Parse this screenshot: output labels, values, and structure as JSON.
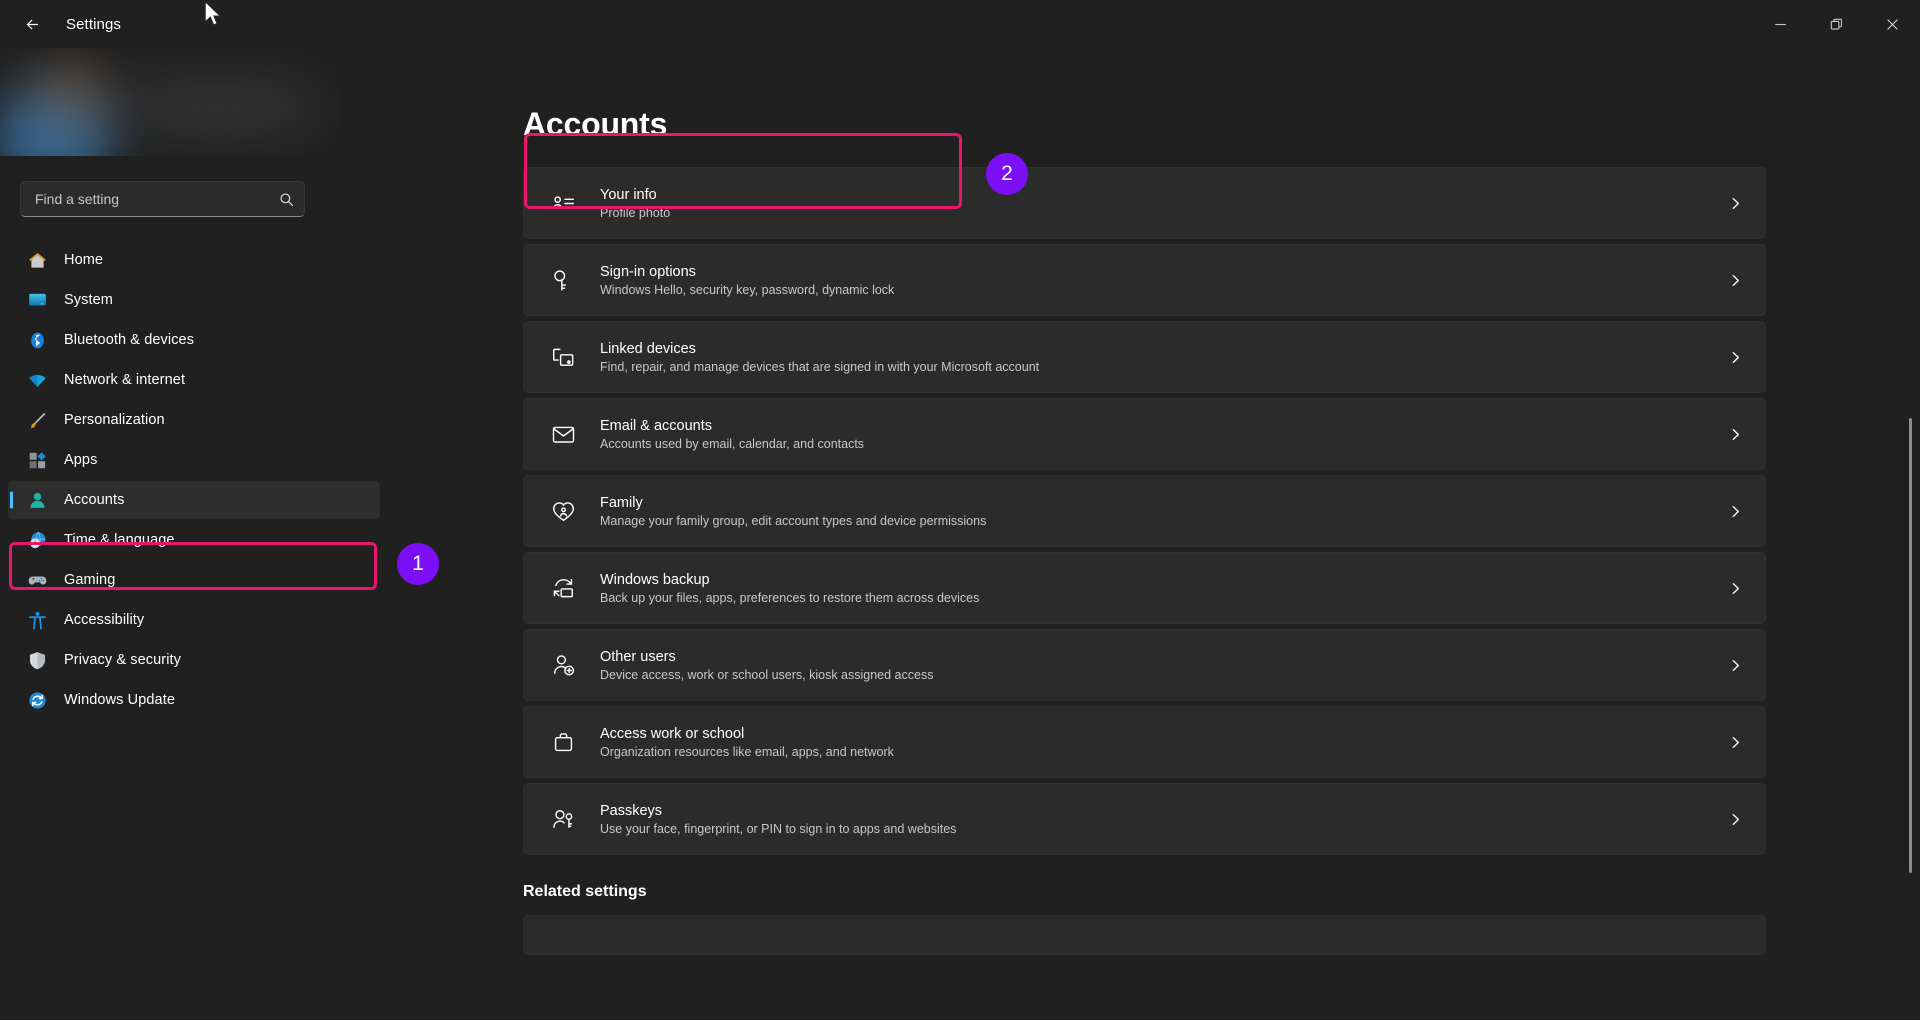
{
  "titlebar": {
    "back_label": "Back",
    "app_title": "Settings",
    "minimize_label": "Minimize",
    "restore_label": "Restore",
    "close_label": "Close"
  },
  "search": {
    "placeholder": "Find a setting",
    "value": ""
  },
  "sidebar": {
    "items": [
      {
        "label": "Home",
        "icon": "home-icon",
        "selected": false
      },
      {
        "label": "System",
        "icon": "system-icon",
        "selected": false
      },
      {
        "label": "Bluetooth & devices",
        "icon": "bluetooth-icon",
        "selected": false
      },
      {
        "label": "Network & internet",
        "icon": "network-icon",
        "selected": false
      },
      {
        "label": "Personalization",
        "icon": "personalization-icon",
        "selected": false
      },
      {
        "label": "Apps",
        "icon": "apps-icon",
        "selected": false
      },
      {
        "label": "Accounts",
        "icon": "accounts-icon",
        "selected": true
      },
      {
        "label": "Time & language",
        "icon": "time-language-icon",
        "selected": false
      },
      {
        "label": "Gaming",
        "icon": "gaming-icon",
        "selected": false
      },
      {
        "label": "Accessibility",
        "icon": "accessibility-icon",
        "selected": false
      },
      {
        "label": "Privacy & security",
        "icon": "privacy-security-icon",
        "selected": false
      },
      {
        "label": "Windows Update",
        "icon": "windows-update-icon",
        "selected": false
      }
    ]
  },
  "main": {
    "page_title": "Accounts",
    "related_title": "Related settings",
    "cards": [
      {
        "title": "Your info",
        "subtitle": "Profile photo",
        "icon": "contact-card-icon"
      },
      {
        "title": "Sign-in options",
        "subtitle": "Windows Hello, security key, password, dynamic lock",
        "icon": "key-icon"
      },
      {
        "title": "Linked devices",
        "subtitle": "Find, repair, and manage devices that are signed in with your Microsoft account",
        "icon": "linked-devices-icon"
      },
      {
        "title": "Email & accounts",
        "subtitle": "Accounts used by email, calendar, and contacts",
        "icon": "envelope-icon"
      },
      {
        "title": "Family",
        "subtitle": "Manage your family group, edit account types and device permissions",
        "icon": "family-heart-icon"
      },
      {
        "title": "Windows backup",
        "subtitle": "Back up your files, apps, preferences to restore them across devices",
        "icon": "backup-icon"
      },
      {
        "title": "Other users",
        "subtitle": "Device access, work or school users, kiosk assigned access",
        "icon": "add-user-icon"
      },
      {
        "title": "Access work or school",
        "subtitle": "Organization resources like email, apps, and network",
        "icon": "briefcase-icon"
      },
      {
        "title": "Passkeys",
        "subtitle": "Use your face, fingerprint, or PIN to sign in to apps and websites",
        "icon": "passkey-icon"
      }
    ]
  },
  "annotations": {
    "badge_1": "1",
    "badge_2": "2",
    "highlight_color": "#e8176b",
    "badge_color": "#7b0ff5"
  }
}
